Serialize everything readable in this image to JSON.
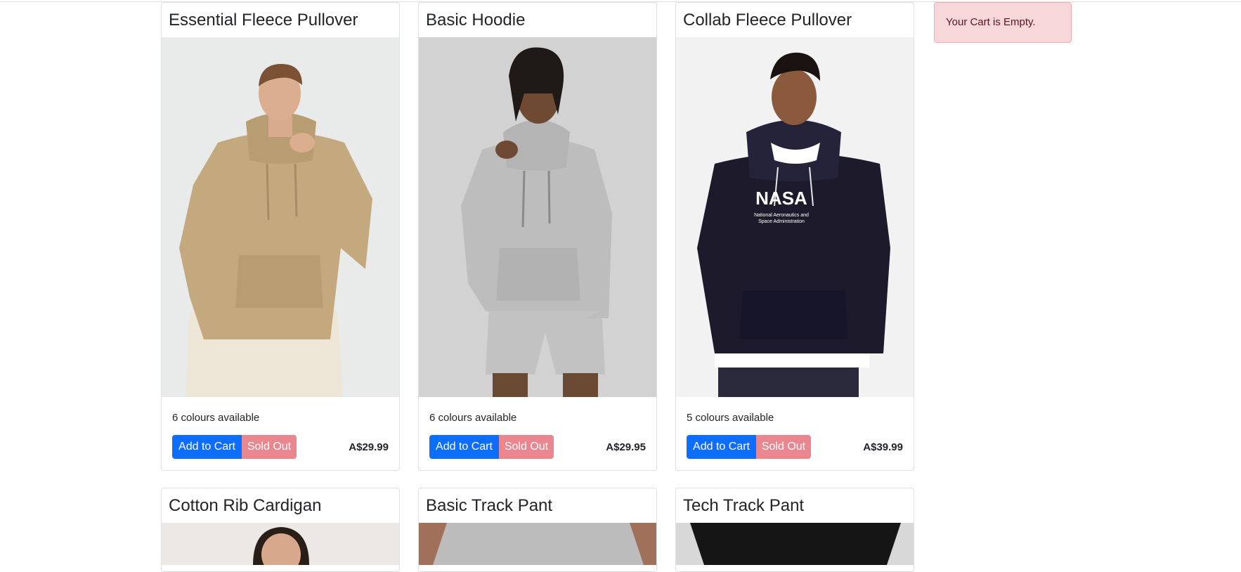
{
  "products": [
    {
      "title": "Essential Fleece Pullover",
      "colours": "6 colours available",
      "add_label": "Add to Cart",
      "sold_label": "Sold Out",
      "price": "A$29.99",
      "image": "tan-hoodie-model-photo"
    },
    {
      "title": "Basic Hoodie",
      "colours": "6 colours available",
      "add_label": "Add to Cart",
      "sold_label": "Sold Out",
      "price": "A$29.95",
      "image": "grey-hoodie-model-photo"
    },
    {
      "title": "Collab Fleece Pullover",
      "colours": "5 colours available",
      "add_label": "Add to Cart",
      "sold_label": "Sold Out",
      "price": "A$39.99",
      "image": "navy-nasa-hoodie-model-photo",
      "image_text_1": "NASA",
      "image_text_2": "National Aeronautics and",
      "image_text_3": "Space Administration"
    },
    {
      "title": "Cotton Rib Cardigan",
      "image": "cardigan-model-photo"
    },
    {
      "title": "Basic Track Pant",
      "image": "track-pant-model-photo"
    },
    {
      "title": "Tech Track Pant",
      "image": "tech-track-pant-model-photo"
    }
  ],
  "cart": {
    "empty_message": "Your Cart is Empty."
  },
  "colors": {
    "primary": "#0d6efd",
    "sold_out": "#ea868f",
    "alert_bg": "#f8d7da",
    "alert_text": "#58151c"
  }
}
